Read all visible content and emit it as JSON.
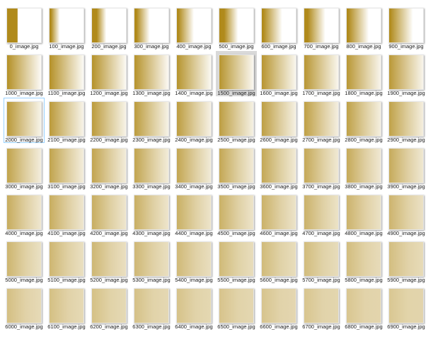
{
  "colors": {
    "gold": "#b08a1b",
    "selected_bg": "#d9d9d9",
    "focus_border": "#99d1ff"
  },
  "selected_item": "1500_image.jpg",
  "focused_item": "2000_image.jpg",
  "files": [
    {
      "name": "0_image.jpg",
      "solid": 0.3,
      "soft": 0.0,
      "fade": 0.32
    },
    {
      "name": "100_image.jpg",
      "solid": 0.04,
      "soft": 0.05,
      "fade": 0.3
    },
    {
      "name": "200_image.jpg",
      "solid": 0.14,
      "soft": 0.1,
      "fade": 0.42
    },
    {
      "name": "300_image.jpg",
      "solid": 0.06,
      "soft": 0.15,
      "fade": 0.45
    },
    {
      "name": "400_image.jpg",
      "solid": 0.04,
      "soft": 0.2,
      "fade": 0.5
    },
    {
      "name": "500_image.jpg",
      "solid": 0.14,
      "soft": 0.25,
      "fade": 0.55
    },
    {
      "name": "600_image.jpg",
      "solid": 0.04,
      "soft": 0.3,
      "fade": 0.6
    },
    {
      "name": "700_image.jpg",
      "solid": 0.1,
      "soft": 0.35,
      "fade": 0.62
    },
    {
      "name": "800_image.jpg",
      "solid": 0.04,
      "soft": 0.4,
      "fade": 0.65
    },
    {
      "name": "900_image.jpg",
      "solid": 0.02,
      "soft": 0.45,
      "fade": 0.7
    },
    {
      "name": "1000_image.jpg",
      "solid": 0.02,
      "soft": 0.5,
      "fade": 1.0
    },
    {
      "name": "1100_image.jpg",
      "solid": 0.02,
      "soft": 0.5,
      "fade": 1.0
    },
    {
      "name": "1200_image.jpg",
      "solid": 0.02,
      "soft": 0.5,
      "fade": 1.0
    },
    {
      "name": "1300_image.jpg",
      "solid": 0.02,
      "soft": 0.5,
      "fade": 1.0
    },
    {
      "name": "1400_image.jpg",
      "solid": 0.02,
      "soft": 0.5,
      "fade": 1.0
    },
    {
      "name": "1500_image.jpg",
      "solid": 0.02,
      "soft": 0.52,
      "fade": 1.0
    },
    {
      "name": "1600_image.jpg",
      "solid": 0.02,
      "soft": 0.52,
      "fade": 1.0
    },
    {
      "name": "1700_image.jpg",
      "solid": 0.02,
      "soft": 0.54,
      "fade": 1.0
    },
    {
      "name": "1800_image.jpg",
      "solid": 0.02,
      "soft": 0.54,
      "fade": 1.0
    },
    {
      "name": "1900_image.jpg",
      "solid": 0.02,
      "soft": 0.56,
      "fade": 1.0
    },
    {
      "name": "2000_image.jpg",
      "solid": 0.02,
      "soft": 0.56,
      "fade": 1.0
    },
    {
      "name": "2100_image.jpg",
      "solid": 0.02,
      "soft": 0.58,
      "fade": 1.0
    },
    {
      "name": "2200_image.jpg",
      "solid": 0.02,
      "soft": 0.58,
      "fade": 1.0
    },
    {
      "name": "2300_image.jpg",
      "solid": 0.02,
      "soft": 0.6,
      "fade": 1.0
    },
    {
      "name": "2400_image.jpg",
      "solid": 0.02,
      "soft": 0.6,
      "fade": 1.0
    },
    {
      "name": "2500_image.jpg",
      "solid": 0.02,
      "soft": 0.62,
      "fade": 1.0
    },
    {
      "name": "2600_image.jpg",
      "solid": 0.02,
      "soft": 0.62,
      "fade": 1.0
    },
    {
      "name": "2700_image.jpg",
      "solid": 0.02,
      "soft": 0.64,
      "fade": 1.0
    },
    {
      "name": "2800_image.jpg",
      "solid": 0.02,
      "soft": 0.64,
      "fade": 1.0
    },
    {
      "name": "2900_image.jpg",
      "solid": 0.02,
      "soft": 0.66,
      "fade": 1.0
    },
    {
      "name": "3000_image.jpg",
      "solid": 0.02,
      "soft": 0.68,
      "fade": 1.0
    },
    {
      "name": "3100_image.jpg",
      "solid": 0.02,
      "soft": 0.68,
      "fade": 1.0
    },
    {
      "name": "3200_image.jpg",
      "solid": 0.02,
      "soft": 0.7,
      "fade": 1.0
    },
    {
      "name": "3300_image.jpg",
      "solid": 0.02,
      "soft": 0.7,
      "fade": 1.0
    },
    {
      "name": "3400_image.jpg",
      "solid": 0.02,
      "soft": 0.72,
      "fade": 1.0
    },
    {
      "name": "3500_image.jpg",
      "solid": 0.02,
      "soft": 0.72,
      "fade": 1.0
    },
    {
      "name": "3600_image.jpg",
      "solid": 0.02,
      "soft": 0.74,
      "fade": 1.0
    },
    {
      "name": "3700_image.jpg",
      "solid": 0.02,
      "soft": 0.74,
      "fade": 1.0
    },
    {
      "name": "3800_image.jpg",
      "solid": 0.02,
      "soft": 0.76,
      "fade": 1.0
    },
    {
      "name": "3900_image.jpg",
      "solid": 0.02,
      "soft": 0.76,
      "fade": 1.0
    },
    {
      "name": "4000_image.jpg",
      "solid": 0.02,
      "soft": 0.78,
      "fade": 1.0
    },
    {
      "name": "4100_image.jpg",
      "solid": 0.02,
      "soft": 0.78,
      "fade": 1.0
    },
    {
      "name": "4200_image.jpg",
      "solid": 0.02,
      "soft": 0.8,
      "fade": 1.0
    },
    {
      "name": "4300_image.jpg",
      "solid": 0.02,
      "soft": 0.8,
      "fade": 1.0
    },
    {
      "name": "4400_image.jpg",
      "solid": 0.02,
      "soft": 0.82,
      "fade": 1.0
    },
    {
      "name": "4500_image.jpg",
      "solid": 0.02,
      "soft": 0.82,
      "fade": 1.0
    },
    {
      "name": "4600_image.jpg",
      "solid": 0.02,
      "soft": 0.84,
      "fade": 1.0
    },
    {
      "name": "4700_image.jpg",
      "solid": 0.02,
      "soft": 0.84,
      "fade": 1.0
    },
    {
      "name": "4800_image.jpg",
      "solid": 0.02,
      "soft": 0.86,
      "fade": 1.0
    },
    {
      "name": "4900_image.jpg",
      "solid": 0.02,
      "soft": 0.86,
      "fade": 1.0
    },
    {
      "name": "5000_image.jpg",
      "solid": 0.02,
      "soft": 0.88,
      "fade": 1.0
    },
    {
      "name": "5100_image.jpg",
      "solid": 0.02,
      "soft": 0.88,
      "fade": 1.0
    },
    {
      "name": "5200_image.jpg",
      "solid": 0.02,
      "soft": 0.9,
      "fade": 1.0
    },
    {
      "name": "5300_image.jpg",
      "solid": 0.02,
      "soft": 0.9,
      "fade": 1.0
    },
    {
      "name": "5400_image.jpg",
      "solid": 0.02,
      "soft": 0.92,
      "fade": 1.0
    },
    {
      "name": "5500_image.jpg",
      "solid": 0.02,
      "soft": 0.92,
      "fade": 1.0
    },
    {
      "name": "5600_image.jpg",
      "solid": 0.02,
      "soft": 0.94,
      "fade": 1.0
    },
    {
      "name": "5700_image.jpg",
      "solid": 0.02,
      "soft": 0.94,
      "fade": 1.0
    },
    {
      "name": "5800_image.jpg",
      "solid": 0.02,
      "soft": 0.96,
      "fade": 1.0
    },
    {
      "name": "5900_image.jpg",
      "solid": 0.02,
      "soft": 0.96,
      "fade": 1.0
    },
    {
      "name": "6000_image.jpg",
      "solid": 0.02,
      "soft": 0.98,
      "fade": 1.0
    },
    {
      "name": "6100_image.jpg",
      "solid": 0.02,
      "soft": 0.98,
      "fade": 1.0
    },
    {
      "name": "6200_image.jpg",
      "solid": 0.02,
      "soft": 1.0,
      "fade": 1.0
    },
    {
      "name": "6300_image.jpg",
      "solid": 0.02,
      "soft": 1.0,
      "fade": 1.0
    },
    {
      "name": "6400_image.jpg",
      "solid": 0.02,
      "soft": 1.0,
      "fade": 1.0
    },
    {
      "name": "6500_image.jpg",
      "solid": 0.02,
      "soft": 1.0,
      "fade": 1.0
    },
    {
      "name": "6600_image.jpg",
      "solid": 0.02,
      "soft": 1.0,
      "fade": 1.0
    },
    {
      "name": "6700_image.jpg",
      "solid": 0.02,
      "soft": 1.0,
      "fade": 1.0
    },
    {
      "name": "6800_image.jpg",
      "solid": 0.02,
      "soft": 1.0,
      "fade": 1.0
    },
    {
      "name": "6900_image.jpg",
      "solid": 0.02,
      "soft": 1.0,
      "fade": 1.0
    }
  ]
}
